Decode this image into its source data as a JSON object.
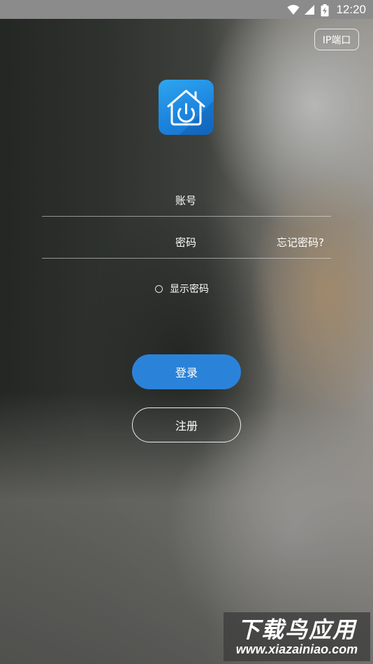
{
  "status_bar": {
    "time": "12:20",
    "icons": [
      "wifi-icon",
      "signal-icon",
      "battery-charging-icon"
    ]
  },
  "header": {
    "ip_port_label": "IP端口"
  },
  "app_icon": {
    "name": "home-power-icon",
    "color": "#1d86df"
  },
  "form": {
    "account_label": "账号",
    "password_label": "密码",
    "forgot_password": "忘记密码?",
    "show_password_label": "显示密码",
    "show_password_checked": false
  },
  "buttons": {
    "login": "登录",
    "register": "注册",
    "login_color": "#2b83d9"
  },
  "watermark": {
    "title": "下载鸟应用",
    "url": "www.xiazainiao.com"
  }
}
